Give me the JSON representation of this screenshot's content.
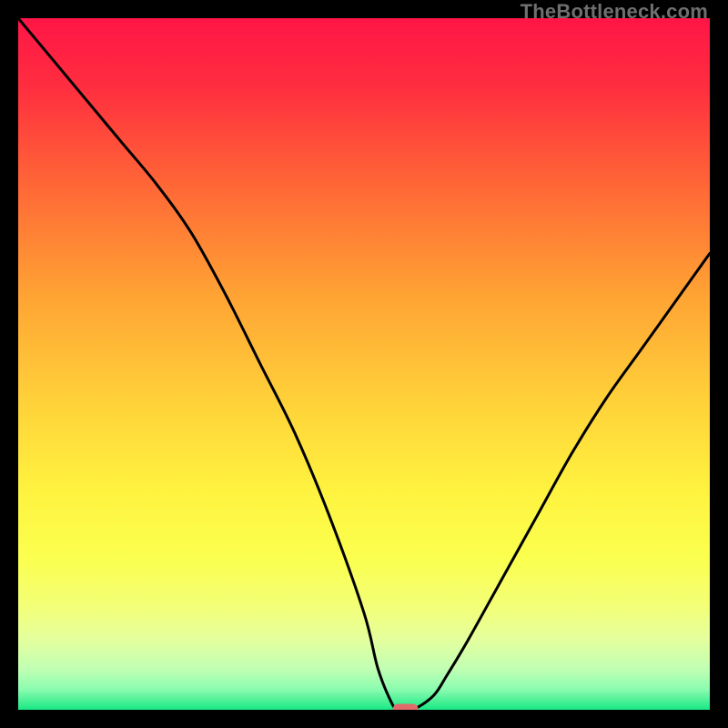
{
  "watermark": "TheBottleneck.com",
  "chart_data": {
    "type": "line",
    "title": "",
    "xlabel": "",
    "ylabel": "",
    "xlim": [
      0,
      100
    ],
    "ylim": [
      0,
      100
    ],
    "x": [
      0,
      5,
      10,
      15,
      20,
      25,
      30,
      35,
      40,
      45,
      50,
      52,
      54,
      55,
      57,
      60,
      62,
      65,
      70,
      75,
      80,
      85,
      90,
      95,
      100
    ],
    "y": [
      100,
      94,
      88,
      82,
      76,
      69,
      60,
      50,
      40,
      28,
      14,
      6,
      1,
      0,
      0,
      2,
      5,
      10,
      19,
      28,
      37,
      45,
      52,
      59,
      66
    ],
    "marker": {
      "x": 56,
      "y": 0
    },
    "gradient_stops": [
      {
        "offset": 0.0,
        "color": "#ff1547"
      },
      {
        "offset": 0.1,
        "color": "#ff2e3f"
      },
      {
        "offset": 0.25,
        "color": "#ff6a36"
      },
      {
        "offset": 0.4,
        "color": "#ffa334"
      },
      {
        "offset": 0.55,
        "color": "#ffd039"
      },
      {
        "offset": 0.68,
        "color": "#fff23f"
      },
      {
        "offset": 0.78,
        "color": "#fbff4e"
      },
      {
        "offset": 0.85,
        "color": "#f3ff77"
      },
      {
        "offset": 0.9,
        "color": "#e3ff9e"
      },
      {
        "offset": 0.94,
        "color": "#c2ffb3"
      },
      {
        "offset": 0.97,
        "color": "#8cfcb0"
      },
      {
        "offset": 1.0,
        "color": "#19e884"
      }
    ]
  }
}
